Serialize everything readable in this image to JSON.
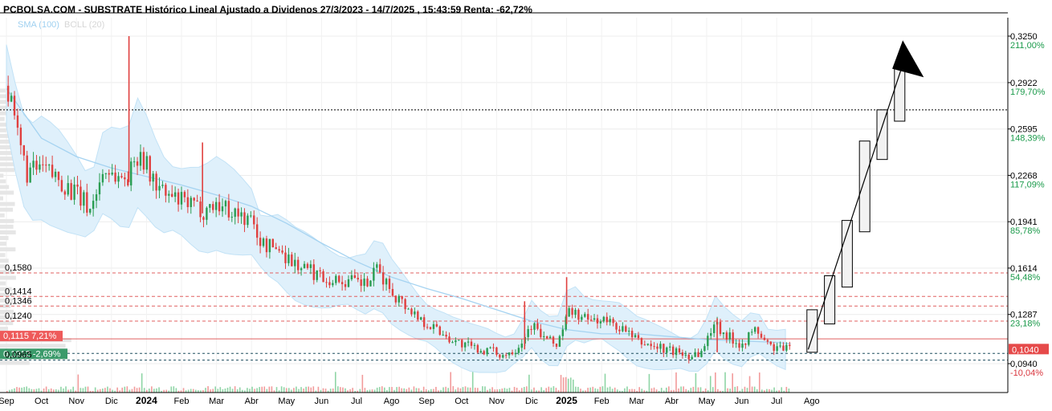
{
  "chart_data": {
    "type": "candlestick",
    "title": "PCBOLSA.COM - SUBSTRATE Histórico Lineal Ajustado a Dividenos 27/3/2023 - 14/7/2025 , 15:43:59 Renta: -62,72%",
    "indicators": [
      "SMA (100)",
      "BOLL (20)"
    ],
    "y_axis": {
      "range": [
        0.09,
        0.335
      ],
      "ticks": [
        {
          "value": 0.325,
          "label": "0,3250",
          "pct": "211,00%"
        },
        {
          "value": 0.2922,
          "label": "0,2922",
          "pct": "179,70%"
        },
        {
          "value": 0.2595,
          "label": "0,2595",
          "pct": "148,39%"
        },
        {
          "value": 0.2268,
          "label": "0,2268",
          "pct": "117,09%"
        },
        {
          "value": 0.1941,
          "label": "0,1941",
          "pct": "85,78%"
        },
        {
          "value": 0.1614,
          "label": "0,1614",
          "pct": "54,48%"
        },
        {
          "value": 0.1287,
          "label": "0,1287",
          "pct": "23,18%"
        },
        {
          "value": 0.094,
          "label": "0,0940",
          "pct": "-10,04%"
        }
      ]
    },
    "x_axis": {
      "labels": [
        {
          "label": "Sep",
          "x": 0,
          "bold": false
        },
        {
          "label": "Oct",
          "x": 1,
          "bold": false
        },
        {
          "label": "Nov",
          "x": 2,
          "bold": false
        },
        {
          "label": "Dic",
          "x": 3,
          "bold": false
        },
        {
          "label": "2024",
          "x": 4,
          "bold": true
        },
        {
          "label": "Feb",
          "x": 5,
          "bold": false
        },
        {
          "label": "Mar",
          "x": 6,
          "bold": false
        },
        {
          "label": "Abr",
          "x": 7,
          "bold": false
        },
        {
          "label": "May",
          "x": 8,
          "bold": false
        },
        {
          "label": "Jun",
          "x": 9,
          "bold": false
        },
        {
          "label": "Jul",
          "x": 10,
          "bold": false
        },
        {
          "label": "Ago",
          "x": 11,
          "bold": false
        },
        {
          "label": "Sep",
          "x": 12,
          "bold": false
        },
        {
          "label": "Oct",
          "x": 13,
          "bold": false
        },
        {
          "label": "Nov",
          "x": 14,
          "bold": false
        },
        {
          "label": "Dic",
          "x": 15,
          "bold": false
        },
        {
          "label": "2025",
          "x": 16,
          "bold": true
        },
        {
          "label": "Feb",
          "x": 17,
          "bold": false
        },
        {
          "label": "Mar",
          "x": 18,
          "bold": false
        },
        {
          "label": "Abr",
          "x": 19,
          "bold": false
        },
        {
          "label": "May",
          "x": 20,
          "bold": false
        },
        {
          "label": "Jun",
          "x": 21,
          "bold": false
        },
        {
          "label": "Jul",
          "x": 22,
          "bold": false
        },
        {
          "label": "Ago",
          "x": 23,
          "bold": false
        }
      ]
    },
    "levels": [
      {
        "value": 0.158,
        "label": "0,1580",
        "style": "dashed-red"
      },
      {
        "value": 0.1414,
        "label": "0,1414",
        "style": "dashed-red"
      },
      {
        "value": 0.1346,
        "label": "0,1346",
        "style": "dashed-red"
      },
      {
        "value": 0.124,
        "label": "0,1240",
        "style": "dashed-red"
      },
      {
        "value": 0.1115,
        "label": "0,1115",
        "style": "solid-red",
        "pct": "7,21%"
      },
      {
        "value": 0.1012,
        "label": "0,1012",
        "style": "dashed-dark",
        "pct": "-2,69%"
      },
      {
        "value": 0.0965,
        "label": "0,0965",
        "style": "dashed-dark"
      },
      {
        "value": 0.273,
        "label": "",
        "style": "dotted-black"
      }
    ],
    "current_price": {
      "value": 0.104,
      "label": "0,1040"
    },
    "price_path": [
      [
        0,
        0.29
      ],
      [
        0.3,
        0.255
      ],
      [
        0.6,
        0.228
      ],
      [
        1.0,
        0.232
      ],
      [
        1.5,
        0.224
      ],
      [
        2.0,
        0.213
      ],
      [
        2.4,
        0.203
      ],
      [
        2.8,
        0.232
      ],
      [
        3.2,
        0.225
      ],
      [
        3.5,
        0.226
      ],
      [
        3.8,
        0.246
      ],
      [
        4.1,
        0.227
      ],
      [
        4.5,
        0.213
      ],
      [
        5.0,
        0.208
      ],
      [
        5.6,
        0.202
      ],
      [
        6.0,
        0.207
      ],
      [
        6.5,
        0.201
      ],
      [
        7.0,
        0.194
      ],
      [
        7.3,
        0.178
      ],
      [
        7.8,
        0.175
      ],
      [
        8.2,
        0.165
      ],
      [
        8.8,
        0.158
      ],
      [
        9.3,
        0.153
      ],
      [
        9.8,
        0.152
      ],
      [
        10.3,
        0.15
      ],
      [
        10.6,
        0.16
      ],
      [
        11.0,
        0.145
      ],
      [
        11.4,
        0.135
      ],
      [
        11.8,
        0.126
      ],
      [
        12.3,
        0.118
      ],
      [
        12.8,
        0.11
      ],
      [
        13.3,
        0.105
      ],
      [
        13.8,
        0.103
      ],
      [
        14.2,
        0.1
      ],
      [
        14.6,
        0.106
      ],
      [
        15.0,
        0.122
      ],
      [
        15.3,
        0.113
      ],
      [
        15.7,
        0.107
      ],
      [
        16.1,
        0.132
      ],
      [
        16.5,
        0.125
      ],
      [
        17.0,
        0.125
      ],
      [
        17.5,
        0.12
      ],
      [
        18.0,
        0.11
      ],
      [
        18.5,
        0.106
      ],
      [
        19.0,
        0.103
      ],
      [
        19.5,
        0.1
      ],
      [
        19.9,
        0.103
      ],
      [
        20.2,
        0.124
      ],
      [
        20.6,
        0.113
      ],
      [
        21.0,
        0.108
      ],
      [
        21.4,
        0.118
      ],
      [
        21.8,
        0.106
      ],
      [
        22.2,
        0.104
      ],
      [
        22.4,
        0.104
      ]
    ],
    "spikes": [
      {
        "x": 3.5,
        "high": 0.325,
        "low": 0.222
      },
      {
        "x": 5.6,
        "high": 0.25,
        "low": 0.2
      },
      {
        "x": 16.0,
        "high": 0.155,
        "low": 0.122
      },
      {
        "x": 20.3,
        "high": 0.126,
        "low": 0.102
      },
      {
        "x": 14.8,
        "high": 0.138,
        "low": 0.104
      }
    ],
    "sma_100": [
      [
        0,
        0.288
      ],
      [
        1,
        0.253
      ],
      [
        2,
        0.24
      ],
      [
        3,
        0.232
      ],
      [
        4,
        0.226
      ],
      [
        5,
        0.22
      ],
      [
        6,
        0.213
      ],
      [
        7,
        0.205
      ],
      [
        8,
        0.193
      ],
      [
        9,
        0.179
      ],
      [
        10,
        0.166
      ],
      [
        11,
        0.155
      ],
      [
        12,
        0.147
      ],
      [
        13,
        0.14
      ],
      [
        14,
        0.132
      ],
      [
        15,
        0.124
      ],
      [
        16,
        0.118
      ],
      [
        17,
        0.115
      ],
      [
        18,
        0.115
      ],
      [
        19,
        0.113
      ],
      [
        20,
        0.111
      ],
      [
        21,
        0.11
      ],
      [
        22,
        0.109
      ],
      [
        22.4,
        0.108
      ]
    ],
    "forecast_boxes": [
      {
        "x": 23.0,
        "low": 0.102,
        "high": 0.132
      },
      {
        "x": 23.5,
        "low": 0.122,
        "high": 0.156
      },
      {
        "x": 24.0,
        "low": 0.148,
        "high": 0.195
      },
      {
        "x": 24.5,
        "low": 0.187,
        "high": 0.251
      },
      {
        "x": 25.0,
        "low": 0.238,
        "high": 0.273
      },
      {
        "x": 25.5,
        "low": 0.265,
        "high": 0.305
      }
    ],
    "legend_placement": "top-left",
    "grid": true
  }
}
